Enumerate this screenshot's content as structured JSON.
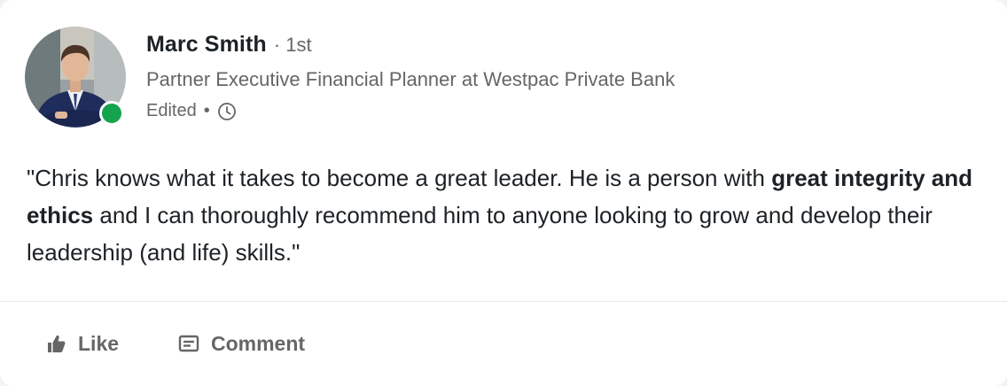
{
  "author": {
    "name": "Marc Smith",
    "degree": "· 1st",
    "headline": "Partner Executive Financial Planner at Westpac Private Bank",
    "edited": "Edited",
    "separator": "•",
    "presence": "online",
    "presence_color": "#14a44d"
  },
  "recommendation": {
    "part1": "\"Chris knows what it takes to become a great leader. He is a person with ",
    "bold": "great integrity and ethics",
    "part2": " and I can thoroughly recommend him to anyone looking to grow and develop their leadership (and life) skills.\""
  },
  "actions": {
    "like_label": "Like",
    "like_icon": "thumbs-up-icon",
    "comment_label": "Comment",
    "comment_icon": "comment-icon"
  },
  "colors": {
    "text_primary": "#1d2226",
    "text_secondary": "#666666",
    "card_bg": "#ffffff"
  }
}
